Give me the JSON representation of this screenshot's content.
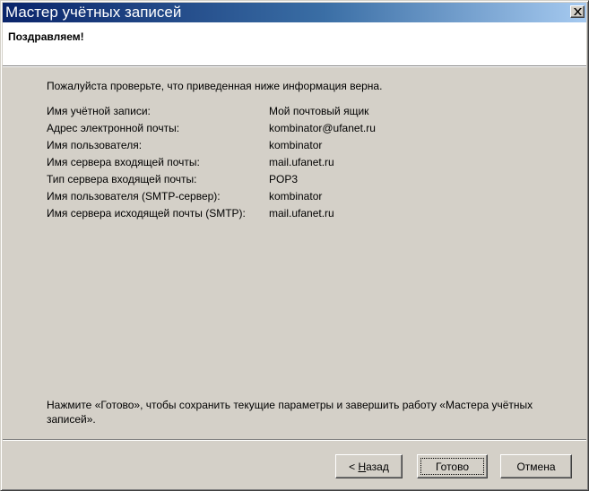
{
  "window": {
    "title": "Мастер учётных записей"
  },
  "header": {
    "title": "Поздравляем!"
  },
  "intro": "Пожалуйста проверьте, что приведенная ниже информация верна.",
  "info": [
    {
      "label": "Имя учётной записи:",
      "value": "Мой почтовый ящик"
    },
    {
      "label": "Адрес электронной почты:",
      "value": "kombinator@ufanet.ru"
    },
    {
      "label": "Имя пользователя:",
      "value": "kombinator"
    },
    {
      "label": "Имя сервера входящей почты:",
      "value": "mail.ufanet.ru"
    },
    {
      "label": "Тип сервера входящей почты:",
      "value": "POP3"
    },
    {
      "label": "Имя пользователя (SMTP-сервер):",
      "value": "kombinator"
    },
    {
      "label": "Имя сервера исходящей почты (SMTP):",
      "value": "mail.ufanet.ru"
    }
  ],
  "outro": "Нажмите «Готово», чтобы сохранить текущие параметры и завершить работу «Мастера учётных записей».",
  "buttons": {
    "back_prefix": "< ",
    "back_accel": "Н",
    "back_rest": "азад",
    "finish": "Готово",
    "cancel": "Отмена"
  },
  "colors": {
    "title_bar_start": "#0a246a",
    "title_bar_end": "#a6caf0",
    "dialog_face": "#d4d0c8"
  },
  "icons": {
    "close": "close-icon"
  }
}
